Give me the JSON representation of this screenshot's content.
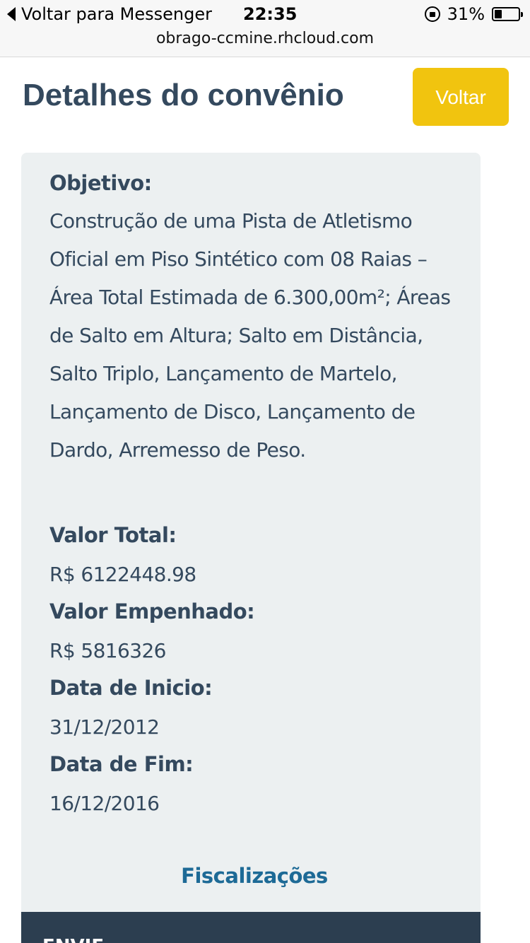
{
  "status_bar": {
    "back_label": "Voltar para Messenger",
    "time": "22:35",
    "battery_percent": "31%",
    "battery_level": 0.31
  },
  "browser": {
    "url": "obrago-ccmine.rhcloud.com"
  },
  "header": {
    "title": "Detalhes do convênio",
    "back_button_label": "Voltar",
    "back_button_color": "#f1c40f"
  },
  "details": {
    "objective_label": "Objetivo:",
    "objective_text": "Construção de uma Pista de Atletismo Oficial em Piso Sintético com 08 Raias – Área Total Estimada de 6.300,00m²; Áreas de Salto em Altura; Salto em Distância, Salto Triplo, Lançamento de Martelo, Lançamento de Disco, Lançamento de Dardo, Arremesso de Peso.",
    "total_value_label": "Valor Total:",
    "total_value": "R$ 6122448.98",
    "committed_value_label": "Valor Empenhado:",
    "committed_value": "R$ 5816326",
    "start_date_label": "Data de Inicio:",
    "start_date": "31/12/2012",
    "end_date_label": "Data de Fim:",
    "end_date": "16/12/2016",
    "inspections_link": "Fiscalizações"
  },
  "footer": {
    "text": "ENVIE"
  },
  "colors": {
    "text_primary": "#34495e",
    "card_background": "#ecf0f1",
    "link": "#1d6a96",
    "footer_background": "#2c3e50"
  }
}
